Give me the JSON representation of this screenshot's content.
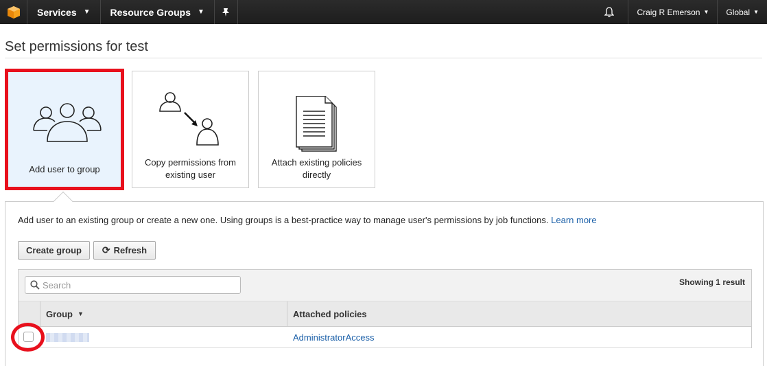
{
  "nav": {
    "services": "Services",
    "resource_groups": "Resource Groups",
    "user": "Craig R Emerson",
    "region": "Global"
  },
  "page": {
    "title": "Set permissions for test"
  },
  "options": [
    {
      "label": "Add user to group"
    },
    {
      "label": "Copy permissions from existing user"
    },
    {
      "label": "Attach existing policies directly"
    }
  ],
  "panel": {
    "description": "Add user to an existing group or create a new one. Using groups is a best-practice way to manage user's permissions by job functions.",
    "learn_more": "Learn more",
    "create_group": "Create group",
    "refresh": "Refresh",
    "search_placeholder": "Search",
    "result_count": "Showing 1 result"
  },
  "table": {
    "columns": [
      "Group",
      "Attached policies"
    ],
    "rows": [
      {
        "group": "",
        "policy": "AdministratorAccess"
      }
    ]
  },
  "colors": {
    "highlight": "#e8101d",
    "selected_tile": "#e9f3fd",
    "link": "#1a5fa8",
    "nav_bg": "#1d1d1d"
  }
}
